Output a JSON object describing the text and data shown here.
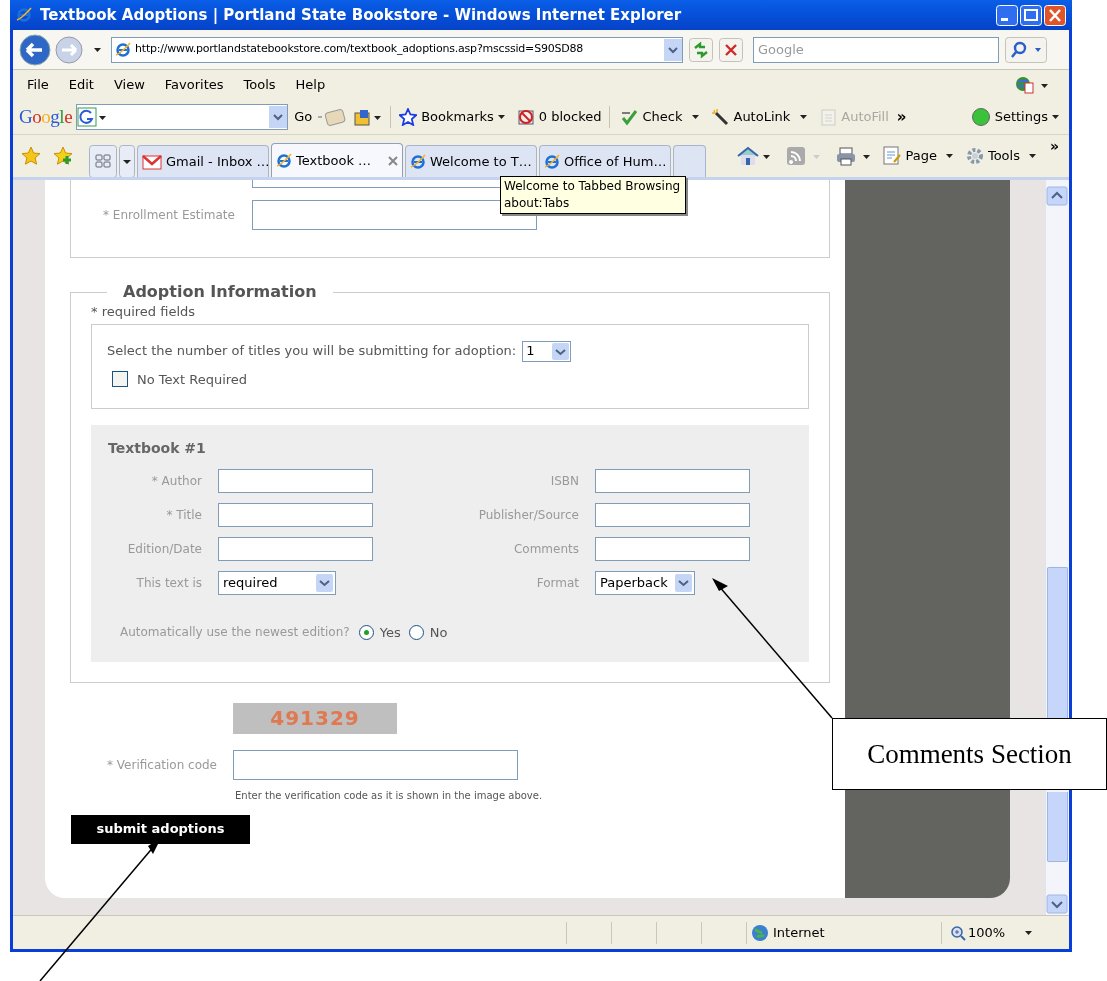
{
  "window": {
    "title": "Textbook Adoptions | Portland State Bookstore - Windows Internet Explorer"
  },
  "address_bar": {
    "url": "http://www.portlandstatebookstore.com/textbook_adoptions.asp?mscssid=S90SD88"
  },
  "search": {
    "placeholder": "Google"
  },
  "menu": [
    "File",
    "Edit",
    "View",
    "Favorites",
    "Tools",
    "Help"
  ],
  "google_toolbar": {
    "logo": "Google",
    "go": "Go",
    "items": [
      {
        "label": "Bookmarks",
        "disabled": false,
        "kind": "star"
      },
      {
        "label": "0 blocked",
        "disabled": false,
        "kind": "blocker"
      },
      {
        "label": "Check",
        "disabled": false,
        "kind": "spell"
      },
      {
        "label": "AutoLink",
        "disabled": false,
        "kind": "wand"
      },
      {
        "label": "AutoFill",
        "disabled": true,
        "kind": "form"
      }
    ],
    "more": "»",
    "settings": "Settings"
  },
  "tabs": [
    {
      "label": "Gmail - Inbox …",
      "selected": false,
      "kind": "mail"
    },
    {
      "label": "Textbook …",
      "selected": true,
      "kind": "web"
    },
    {
      "label": "Welcome to T…",
      "selected": false,
      "kind": "web"
    },
    {
      "label": "Office of Hum…",
      "selected": false,
      "kind": "web"
    }
  ],
  "command_bar": {
    "items": [
      "Page",
      "Tools"
    ],
    "more": "»"
  },
  "tooltip": {
    "lines": [
      "Welcome to Tabbed Browsing",
      "about:Tabs"
    ]
  },
  "form": {
    "enrollment": {
      "label": "* Enrollment Estimate"
    },
    "adoption": {
      "legend": "Adoption Information",
      "note": "* required fields",
      "titles_prompt": "Select the number of titles you will be submitting for adoption:",
      "titles_count": "1",
      "no_text_required": {
        "label": "No Text Required",
        "checked": false
      }
    },
    "textbook": {
      "heading": "Textbook #1",
      "left_fields": [
        {
          "label": "* Author",
          "kind": "text"
        },
        {
          "label": "* Title",
          "kind": "text"
        },
        {
          "label": "Edition/Date",
          "kind": "text"
        },
        {
          "label": "This text is",
          "kind": "select",
          "value": "required"
        }
      ],
      "right_fields": [
        {
          "label": "ISBN",
          "kind": "text"
        },
        {
          "label": "Publisher/Source",
          "kind": "text"
        },
        {
          "label": "Comments",
          "kind": "text"
        },
        {
          "label": "Format",
          "kind": "select",
          "value": "Paperback"
        }
      ],
      "newest_edition": {
        "question": "Automatically use the newest edition?",
        "options": [
          {
            "label": "Yes",
            "selected": true
          },
          {
            "label": "No",
            "selected": false
          }
        ]
      }
    },
    "captcha": {
      "code": "491329"
    },
    "verification": {
      "label": "* Verification code",
      "hint": "Enter the verification code as it is shown in the image above."
    },
    "submit": "submit adoptions"
  },
  "status_bar": {
    "zone": "Internet",
    "zoom": "100%"
  },
  "annotations": [
    {
      "label": "Comments Section"
    }
  ]
}
